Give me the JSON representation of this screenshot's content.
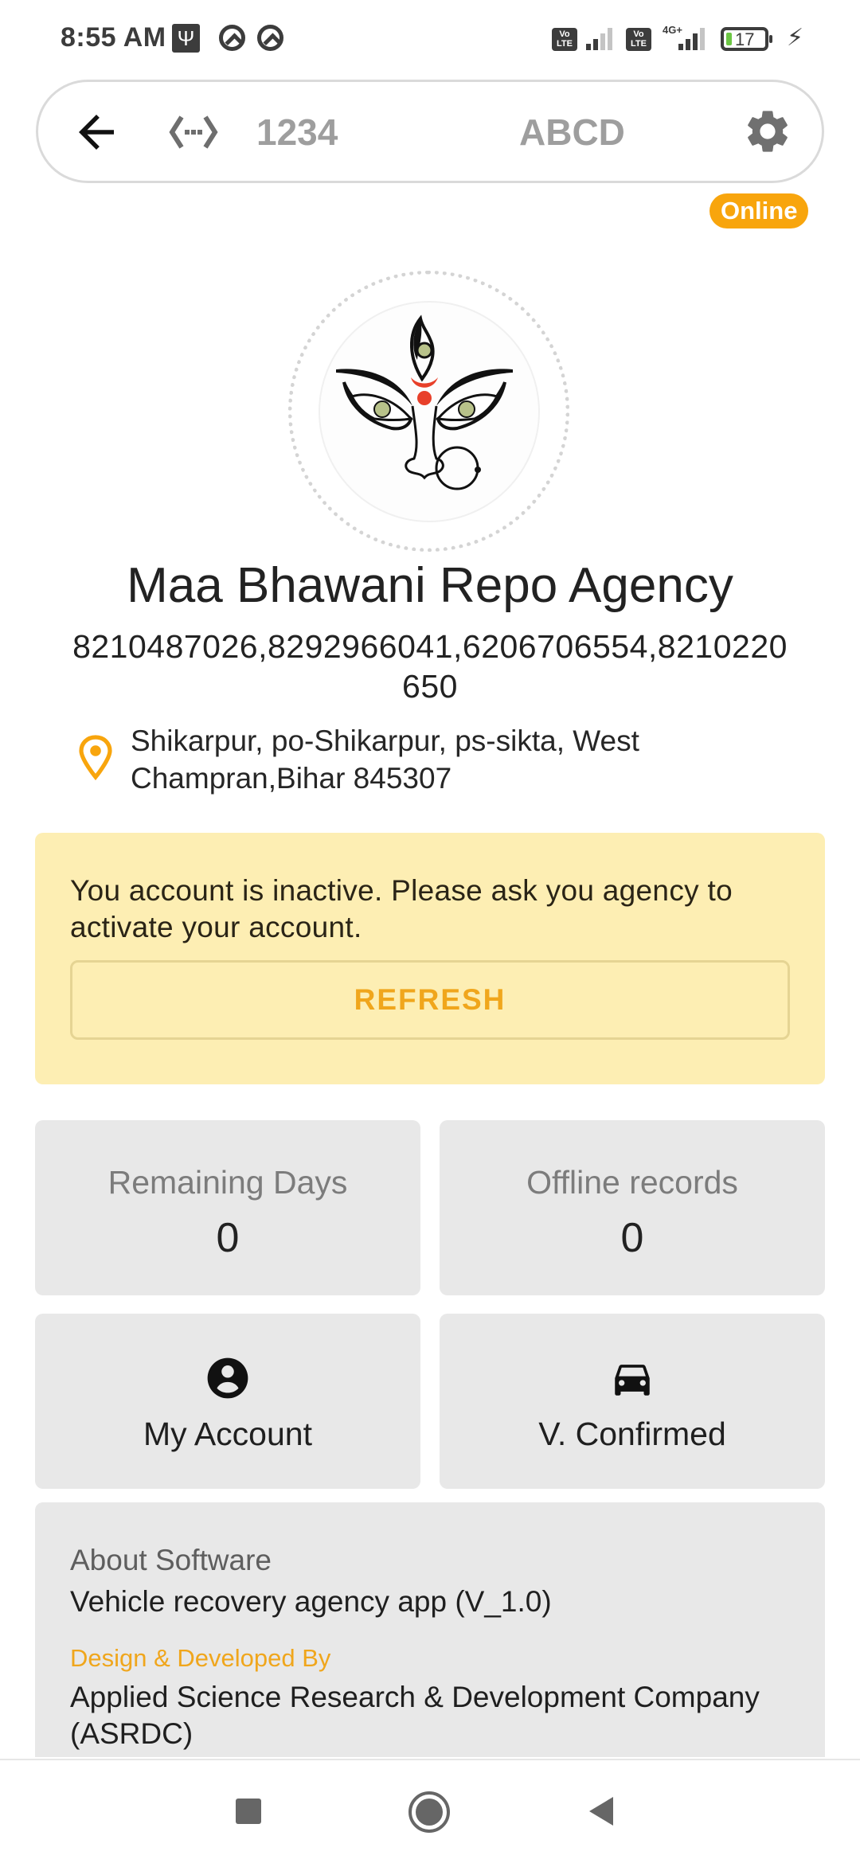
{
  "status_bar": {
    "time": "8:55 AM",
    "usb_icon": "usb-icon",
    "notification_icons": [
      "q-app-icon",
      "q-app-icon"
    ],
    "sim1": {
      "badge_top": "Vo",
      "badge_bottom": "LTE"
    },
    "sim2": {
      "badge_top": "Vo",
      "badge_bottom": "LTE",
      "network": "4G+"
    },
    "battery_level": "17",
    "charging": true
  },
  "top_bar": {
    "back_icon": "arrow-left-icon",
    "code_icon": "settings-ethernet-icon",
    "id_text": "1234",
    "name_text": "ABCD",
    "settings_icon": "gear-icon"
  },
  "connection_status": "Online",
  "profile": {
    "agency_name": "Maa Bhawani Repo Agency",
    "phones": "8210487026,8292966041,6206706554,8210220650",
    "address": "Shikarpur, po-Shikarpur, ps-sikta, West Champran,Bihar 845307"
  },
  "warning": {
    "message": "You account is inactive. Please ask you agency to activate your account.",
    "button_label": "REFRESH"
  },
  "stats": [
    {
      "label": "Remaining Days",
      "value": "0"
    },
    {
      "label": "Offline records",
      "value": "0"
    }
  ],
  "actions": [
    {
      "label": "My Account",
      "icon": "account-circle-icon"
    },
    {
      "label": "V. Confirmed",
      "icon": "car-icon"
    }
  ],
  "about": {
    "title": "About Software",
    "app_name": "Vehicle recovery agency app (V_1.0)",
    "developer_label": "Design & Developed By",
    "developer": "Applied Science Research & Development Company (ASRDC)"
  },
  "colors": {
    "accent": "#f8a50d",
    "warning_bg": "#fdeeb3",
    "tile_bg": "#e8e8e8"
  }
}
